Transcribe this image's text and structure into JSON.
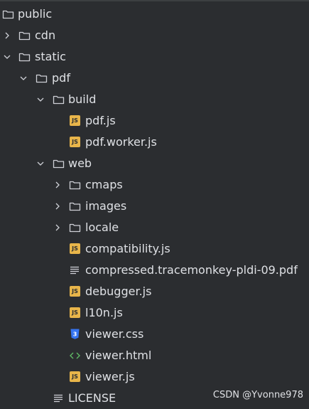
{
  "tree": {
    "public": "public",
    "cdn": "cdn",
    "static": "static",
    "pdf": "pdf",
    "build": "build",
    "pdf_js": "pdf.js",
    "pdf_worker_js": "pdf.worker.js",
    "web": "web",
    "cmaps": "cmaps",
    "images": "images",
    "locale": "locale",
    "compatibility_js": "compatibility.js",
    "compressed_pdf": "compressed.tracemonkey-pldi-09.pdf",
    "debugger_js": "debugger.js",
    "l10n_js": "l10n.js",
    "viewer_css": "viewer.css",
    "viewer_html": "viewer.html",
    "viewer_js": "viewer.js",
    "license": "LICENSE"
  },
  "badges": {
    "js": "JS",
    "css": "3"
  },
  "watermark": "CSDN @Yvonne978",
  "colors": {
    "background": "#2b2d30",
    "text": "#dfe1e5",
    "folder_outline": "#ced0d6",
    "js_badge": "#e8b54a",
    "css_badge": "#3574f0",
    "html_icon": "#5fb865"
  },
  "icons": {
    "folder": "folder-icon",
    "js": "js-file-icon",
    "css": "css-file-icon",
    "html": "html-file-icon",
    "text": "text-file-icon",
    "chevron_right": "chevron-right-icon",
    "chevron_down": "chevron-down-icon"
  }
}
